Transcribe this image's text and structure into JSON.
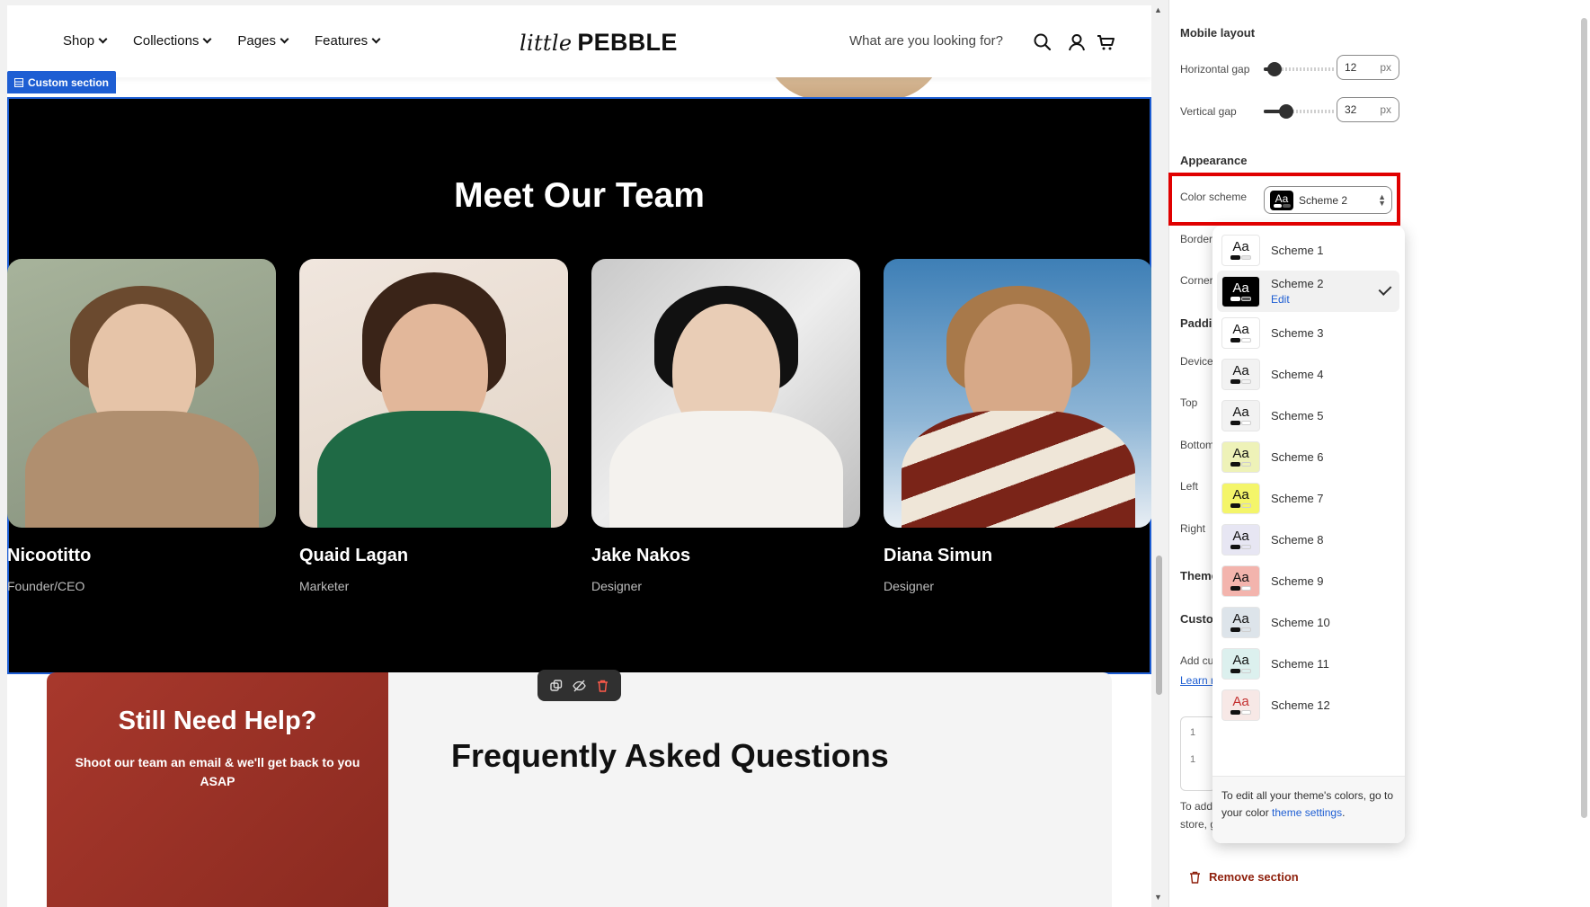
{
  "storefront": {
    "nav": [
      {
        "label": "Shop"
      },
      {
        "label": "Collections"
      },
      {
        "label": "Pages"
      },
      {
        "label": "Features"
      }
    ],
    "logo_script": "little",
    "logo_text": "PEBBLE",
    "search_placeholder": "What are you looking for?",
    "section_tag": "Custom section",
    "team_title": "Meet Our Team",
    "members": [
      {
        "name": "Nicootitto",
        "role": "Founder/CEO"
      },
      {
        "name": "Quaid Lagan",
        "role": "Marketer"
      },
      {
        "name": "Jake Nakos",
        "role": "Designer"
      },
      {
        "name": "Diana Simun",
        "role": "Designer"
      }
    ],
    "help_title": "Still Need Help?",
    "help_text": "Shoot our team an email & we'll get back to you ASAP",
    "faq_title": "Frequently Asked Questions"
  },
  "panel": {
    "mobile_layout": "Mobile layout",
    "horizontal_gap_label": "Horizontal gap",
    "horizontal_gap_value": "12",
    "horizontal_gap_fraction": 0.15,
    "vertical_gap_label": "Vertical gap",
    "vertical_gap_value": "32",
    "vertical_gap_fraction": 0.32,
    "unit": "px",
    "appearance": "Appearance",
    "color_scheme_label": "Color scheme",
    "color_scheme_value": "Scheme 2",
    "hidden_labels": {
      "border": "Border",
      "corner": "Corner",
      "padding": "Paddir",
      "device": "Device",
      "top": "Top",
      "bottom": "Bottom",
      "left": "Left",
      "right": "Right",
      "theme": "Theme",
      "custom": "Custor",
      "add_custom": "Add cu",
      "learn": "Learn r",
      "to_add": "To add",
      "store": "store, g"
    },
    "code_line_numbers": [
      "1",
      "1"
    ],
    "schemes": [
      {
        "label": "Scheme 1",
        "bg": "#ffffff",
        "text": "#111111",
        "b1": "#111111",
        "b2": "#e6e6e6"
      },
      {
        "label": "Scheme 2",
        "bg": "#000000",
        "text": "#ffffff",
        "b1": "#ffffff",
        "b2": "#555555",
        "selected": true,
        "edit": "Edit"
      },
      {
        "label": "Scheme 3",
        "bg": "#ffffff",
        "text": "#111111",
        "b1": "#111111",
        "b2": "#ffffff"
      },
      {
        "label": "Scheme 4",
        "bg": "#f2f2f2",
        "text": "#111111",
        "b1": "#111111",
        "b2": "#f2f2f2"
      },
      {
        "label": "Scheme 5",
        "bg": "#f2f2f2",
        "text": "#111111",
        "b1": "#111111",
        "b2": "#ffffff"
      },
      {
        "label": "Scheme 6",
        "bg": "#eef2b8",
        "text": "#111111",
        "b1": "#111111",
        "b2": "#eef2b8"
      },
      {
        "label": "Scheme 7",
        "bg": "#f4f56a",
        "text": "#111111",
        "b1": "#111111",
        "b2": "#f4f56a"
      },
      {
        "label": "Scheme 8",
        "bg": "#e7e6f3",
        "text": "#111111",
        "b1": "#111111",
        "b2": "#e7e6f3"
      },
      {
        "label": "Scheme 9",
        "bg": "#f3b4ad",
        "text": "#111111",
        "b1": "#111111",
        "b2": "#ffffff"
      },
      {
        "label": "Scheme 10",
        "bg": "#dde4ea",
        "text": "#111111",
        "b1": "#111111",
        "b2": "#dde4ea"
      },
      {
        "label": "Scheme 11",
        "bg": "#dcf0ee",
        "text": "#111111",
        "b1": "#111111",
        "b2": "#dcf0ee"
      },
      {
        "label": "Scheme 12",
        "bg": "#f7e8e6",
        "text": "#c43030",
        "b1": "#111111",
        "b2": "#ffffff"
      }
    ],
    "footer_text": "To edit all your theme's colors, go to your color",
    "footer_link": "theme settings",
    "footer_end": ".",
    "remove_section": "Remove section"
  }
}
